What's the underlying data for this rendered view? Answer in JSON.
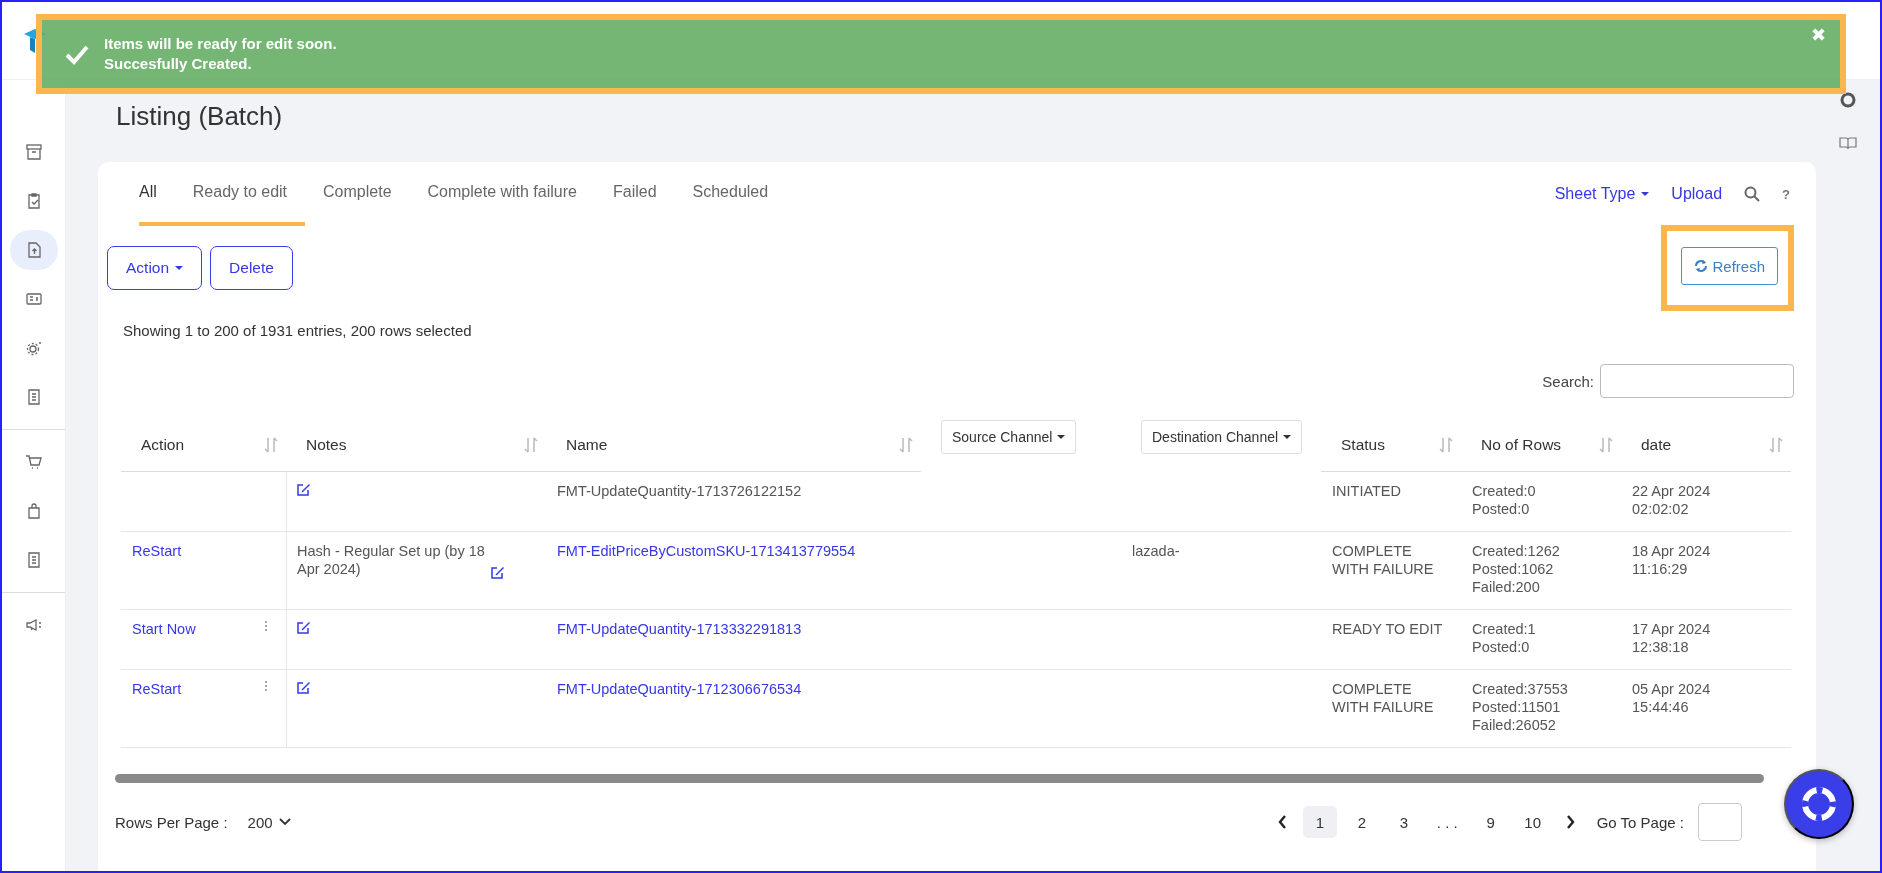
{
  "toast": {
    "title": "Items will be ready for edit soon.",
    "message": "Succesfully Created.",
    "close": "✖",
    "highlighted": true
  },
  "sidebar": {
    "groups": [
      [
        {
          "selected": false
        },
        {
          "selected": false
        },
        {
          "selected": true
        },
        {
          "selected": false
        },
        {
          "selected": false
        },
        {
          "selected": false
        }
      ],
      [
        {
          "selected": false
        },
        {
          "selected": false
        },
        {
          "selected": false
        }
      ],
      [
        {
          "selected": false
        }
      ]
    ]
  },
  "page_title": "Listing (Batch)",
  "tabs": [
    {
      "label": "All",
      "selected": true,
      "highlighted": true
    },
    {
      "label": "Ready to edit",
      "selected": false,
      "highlighted": true
    },
    {
      "label": "Complete",
      "selected": false,
      "highlighted": false
    },
    {
      "label": "Complete with failure",
      "selected": false,
      "highlighted": false
    },
    {
      "label": "Failed",
      "selected": false,
      "highlighted": false
    },
    {
      "label": "Scheduled",
      "selected": false,
      "highlighted": false
    }
  ],
  "toolbar": {
    "links": [
      {
        "label": "Sheet Type",
        "dropdown": true
      },
      {
        "label": "Upload",
        "dropdown": false
      }
    ],
    "help": "?"
  },
  "buttons": [
    {
      "label": "Action",
      "dropdown": true
    },
    {
      "label": "Delete",
      "dropdown": false
    }
  ],
  "refresh": {
    "label": "Refresh",
    "highlighted": true
  },
  "summary": "Showing 1 to 200 of 1931 entries, 200 rows selected",
  "search": {
    "label": "Search:"
  },
  "table": {
    "columns": [
      {
        "label": "Action",
        "kind": "sort"
      },
      {
        "label": "Notes",
        "kind": "sort"
      },
      {
        "label": "Name",
        "kind": "sort"
      },
      {
        "label": "Source Channel",
        "kind": "dropdown"
      },
      {
        "label": "Destination Channel",
        "kind": "dropdown"
      },
      {
        "label": "Status",
        "kind": "sort"
      },
      {
        "label": "No of Rows",
        "kind": "sort"
      },
      {
        "label": "date",
        "kind": "sort"
      }
    ],
    "rows": [
      {
        "action": "",
        "menu": false,
        "notes": "",
        "name": "FMT-UpdateQuantity-1713726122152",
        "name_link": false,
        "destination": "",
        "status": [
          "INITIATED"
        ],
        "counts": [
          "Created:0",
          "Posted:0"
        ],
        "date": [
          "22 Apr 2024",
          "02:02:02"
        ]
      },
      {
        "action": "ReStart",
        "menu": false,
        "notes": "Hash - Regular Set up (by 18 Apr 2024)",
        "name": "FMT-EditPriceByCustomSKU-1713413779554",
        "name_link": true,
        "destination": "lazada-",
        "status": [
          "COMPLETE",
          "WITH FAILURE"
        ],
        "counts": [
          "Created:1262",
          "Posted:1062",
          "Failed:200"
        ],
        "date": [
          "18 Apr 2024",
          "11:16:29"
        ]
      },
      {
        "action": "Start Now",
        "menu": true,
        "notes": "",
        "name": "FMT-UpdateQuantity-1713332291813",
        "name_link": true,
        "destination": "",
        "status": [
          "READY TO EDIT"
        ],
        "counts": [
          "Created:1",
          "Posted:0"
        ],
        "date": [
          "17 Apr 2024",
          "12:38:18"
        ]
      },
      {
        "action": "ReStart",
        "menu": true,
        "notes": "",
        "name": "FMT-UpdateQuantity-1712306676534",
        "name_link": true,
        "destination": "",
        "status": [
          "COMPLETE",
          "WITH FAILURE"
        ],
        "counts": [
          "Created:37553",
          "Posted:11501",
          "Failed:26052"
        ],
        "date": [
          "05 Apr 2024",
          "15:44:46"
        ]
      }
    ]
  },
  "footer": {
    "rows_per_page": {
      "label": "Rows Per Page :",
      "value": "200"
    },
    "pages": [
      {
        "label": "1",
        "selected": true
      },
      {
        "label": "2",
        "selected": false
      },
      {
        "label": "3",
        "selected": false
      },
      {
        "label": ". . .",
        "selected": false
      },
      {
        "label": "9",
        "selected": false
      },
      {
        "label": "10",
        "selected": false
      }
    ],
    "goto": {
      "label": "Go To Page :"
    }
  }
}
